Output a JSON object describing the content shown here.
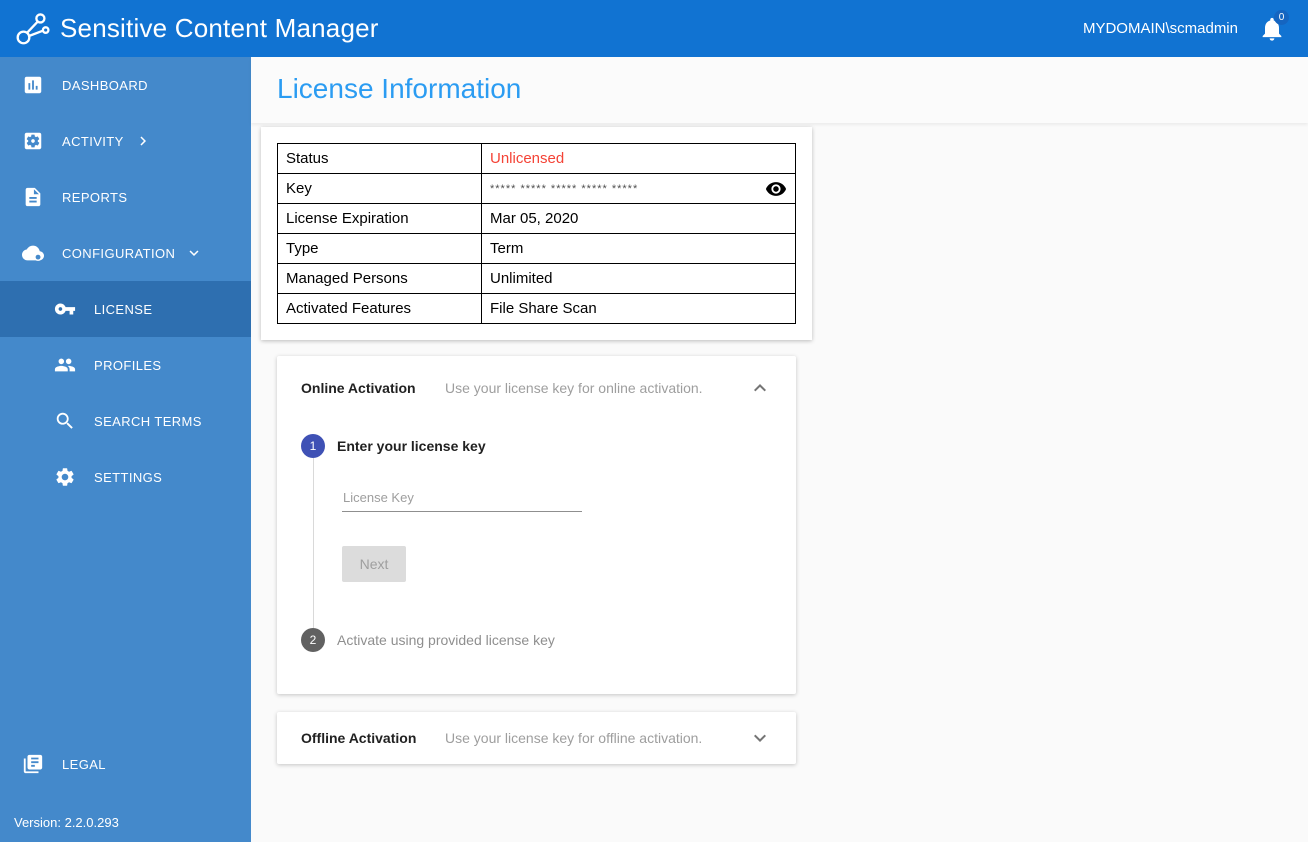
{
  "colors": {
    "topbar_blue": "#1173d2",
    "sidebar_blue": "#4489cb",
    "sidebar_selected_blue": "#2e6fb0",
    "title_blue": "#2b9cf2",
    "status_red": "#f44336",
    "step_active": "#3f51b5",
    "step_inactive": "#616161"
  },
  "topbar": {
    "title": "Sensitive Content Manager",
    "user": "MYDOMAIN\\scmadmin",
    "notification_count": "0"
  },
  "sidebar": {
    "items": {
      "dashboard": "DASHBOARD",
      "activity": "ACTIVITY",
      "reports": "REPORTS",
      "configuration": "CONFIGURATION",
      "license": "LICENSE",
      "profiles": "PROFILES",
      "search_terms": "SEARCH TERMS",
      "settings": "SETTINGS",
      "legal": "LEGAL"
    },
    "version": "Version: 2.2.0.293"
  },
  "main": {
    "title": "License Information",
    "license_table": {
      "rows": [
        {
          "label": "Status",
          "value": "Unlicensed"
        },
        {
          "label": "Key",
          "value": "***** ***** ***** ***** *****"
        },
        {
          "label": "License Expiration",
          "value": "Mar 05, 2020"
        },
        {
          "label": "Type",
          "value": "Term"
        },
        {
          "label": "Managed Persons",
          "value": "Unlimited"
        },
        {
          "label": "Activated Features",
          "value": "File Share Scan"
        }
      ]
    },
    "online_activation": {
      "title": "Online Activation",
      "subtitle": "Use your license key for online activation.",
      "step1_number": "1",
      "step1_label": "Enter your license key",
      "license_key_placeholder": "License Key",
      "next_label": "Next",
      "step2_number": "2",
      "step2_label": "Activate using provided license key"
    },
    "offline_activation": {
      "title": "Offline Activation",
      "subtitle": "Use your license key for offline activation."
    }
  }
}
